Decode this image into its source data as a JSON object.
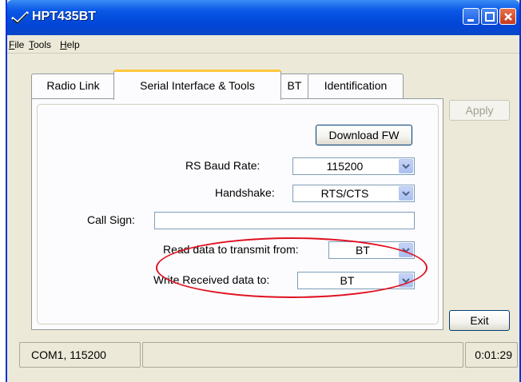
{
  "window": {
    "title": "HPT435BT",
    "icon": "app-check-icon"
  },
  "menu": {
    "items": [
      {
        "accel": "F",
        "rest": "ile"
      },
      {
        "accel": "T",
        "rest": "ools"
      },
      {
        "accel": "H",
        "rest": "elp"
      }
    ]
  },
  "tabs": [
    {
      "label": "Radio Link",
      "active": false
    },
    {
      "label": "Serial Interface & Tools",
      "active": true
    },
    {
      "label": "BT",
      "active": false
    },
    {
      "label": "Identification",
      "active": false
    }
  ],
  "buttons": {
    "apply": "Apply",
    "download_fw": "Download FW",
    "exit": "Exit"
  },
  "form": {
    "rs_baud_rate": {
      "label": "RS Baud Rate:",
      "value": "115200"
    },
    "handshake": {
      "label": "Handshake:",
      "value": "RTS/CTS"
    },
    "call_sign": {
      "label": "Call Sign:",
      "value": ""
    },
    "read_data": {
      "label": "Read data to transmit from:",
      "value": "BT"
    },
    "write_data": {
      "label": "Write Received data to:",
      "value": "BT"
    }
  },
  "status": {
    "port": "COM1, 115200",
    "middle": "",
    "time": "0:01:29"
  },
  "colors": {
    "titlebar": "#0146d6",
    "tab_highlight": "#ffc83c",
    "annotation": "#e01020"
  }
}
